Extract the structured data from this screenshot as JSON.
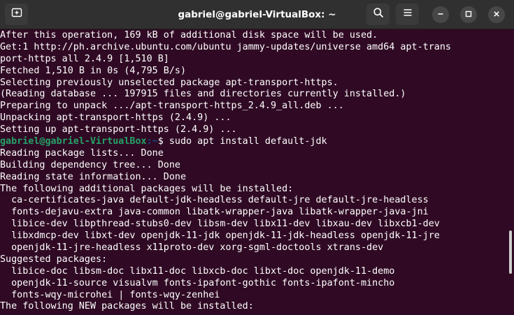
{
  "window": {
    "title": "gabriel@gabriel-VirtualBox: ~"
  },
  "icons": {
    "new_tab": "new-tab-icon",
    "search": "search-icon",
    "menu": "hamburger-menu-icon",
    "minimize": "minimize-icon",
    "maximize": "maximize-icon",
    "close": "close-icon"
  },
  "colors": {
    "terminal_bg": "#300a24",
    "titlebar_bg": "#303030",
    "prompt_user": "#26a269",
    "prompt_path": "#12488b",
    "text": "#ffffff"
  },
  "terminal": {
    "lines_before": [
      "After this operation, 169 kB of additional disk space will be used.",
      "Get:1 http://ph.archive.ubuntu.com/ubuntu jammy-updates/universe amd64 apt-trans",
      "port-https all 2.4.9 [1,510 B]",
      "Fetched 1,510 B in 0s (4,795 B/s)",
      "Selecting previously unselected package apt-transport-https.",
      "(Reading database ... 197915 files and directories currently installed.)",
      "Preparing to unpack .../apt-transport-https_2.4.9_all.deb ...",
      "Unpacking apt-transport-https (2.4.9) ...",
      "Setting up apt-transport-https (2.4.9) ..."
    ],
    "prompt": {
      "user_host": "gabriel@gabriel-VirtualBox",
      "path": ":~",
      "symbol": "$ ",
      "command": "sudo apt install default-jdk"
    },
    "lines_after": [
      "Reading package lists... Done",
      "Building dependency tree... Done",
      "Reading state information... Done",
      "The following additional packages will be installed:",
      "  ca-certificates-java default-jdk-headless default-jre default-jre-headless",
      "  fonts-dejavu-extra java-common libatk-wrapper-java libatk-wrapper-java-jni",
      "  libice-dev libpthread-stubs0-dev libsm-dev libx11-dev libxau-dev libxcb1-dev",
      "  libxdmcp-dev libxt-dev openjdk-11-jdk openjdk-11-jdk-headless openjdk-11-jre",
      "  openjdk-11-jre-headless x11proto-dev xorg-sgml-doctools xtrans-dev",
      "Suggested packages:",
      "  libice-doc libsm-doc libx11-doc libxcb-doc libxt-doc openjdk-11-demo",
      "  openjdk-11-source visualvm fonts-ipafont-gothic fonts-ipafont-mincho",
      "  fonts-wqy-microhei | fonts-wqy-zenhei",
      "The following NEW packages will be installed:"
    ]
  }
}
